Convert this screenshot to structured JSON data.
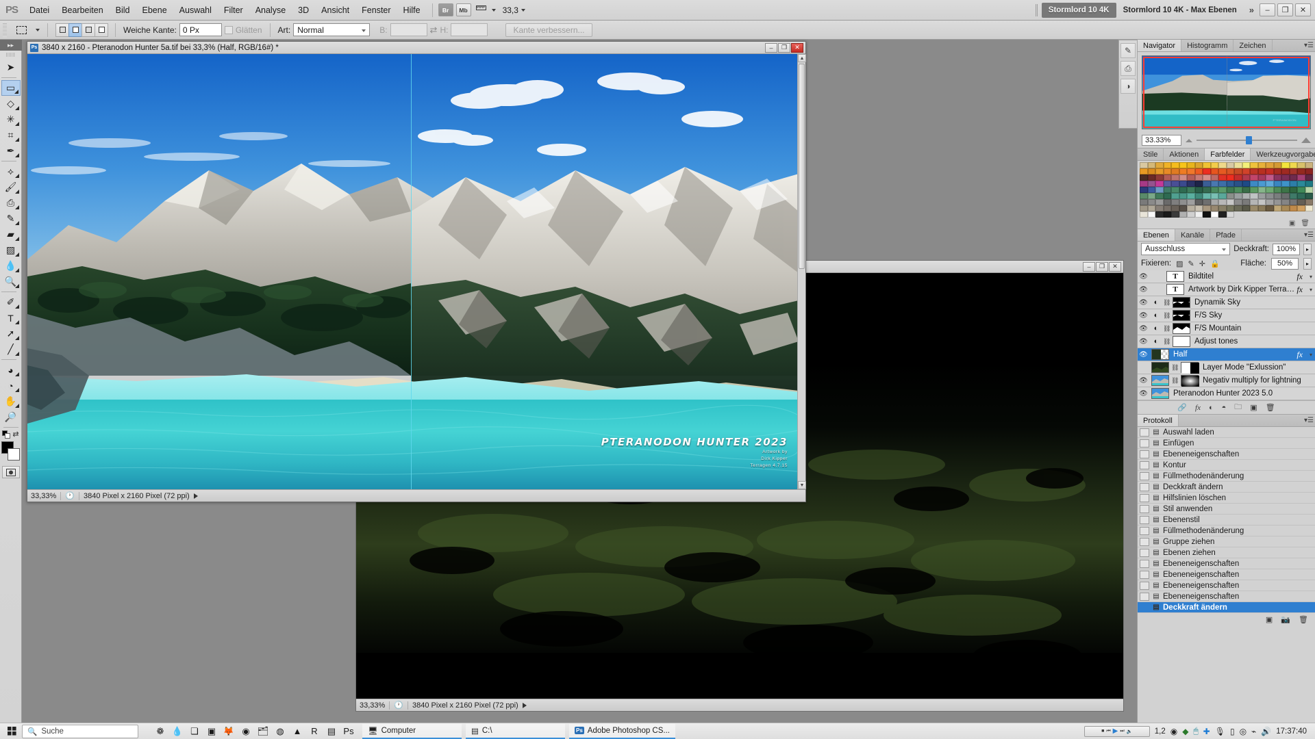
{
  "app": {
    "logo": "PS",
    "menus": [
      "Datei",
      "Bearbeiten",
      "Bild",
      "Ebene",
      "Auswahl",
      "Filter",
      "Analyse",
      "3D",
      "Ansicht",
      "Fenster",
      "Hilfe"
    ],
    "bridge_label": "Br",
    "minibridge_label": "Mb",
    "view_extras_icon": "ruler-icon",
    "zoom_level": "33,3",
    "workspace_tab_active": "Stormlord 10 4K",
    "workspace_tab_secondary": "Stormlord 10 4K - Max Ebenen",
    "overflow_icon": "chevron-double-right-icon",
    "window_minimize": "–",
    "window_restore": "❐",
    "window_close": "✕"
  },
  "options_bar": {
    "tool_icon": "rectangular-marquee-icon",
    "selection_modes": [
      "new-selection",
      "add-to-selection",
      "subtract-from-selection",
      "intersect-selection"
    ],
    "selection_mode_active_index": 1,
    "feather_label": "Weiche Kante:",
    "feather_value": "0 Px",
    "antialias_label": "Glätten",
    "antialias_checked": false,
    "style_label": "Art:",
    "style_value": "Normal",
    "width_label": "B:",
    "width_value": "",
    "swap_icon": "swap-arrows-icon",
    "height_label": "H:",
    "height_value": "",
    "refine_edge_label": "Kante verbessern..."
  },
  "toolbox": {
    "collapse_icon": "double-chevron-right-icon",
    "tools": [
      {
        "name": "move-tool",
        "glyph": "➤",
        "sub": false,
        "selected": false
      },
      {
        "name": "rectangular-marquee-tool",
        "glyph": "▭",
        "sub": true,
        "selected": true
      },
      {
        "name": "lasso-tool",
        "glyph": "◇",
        "sub": true,
        "selected": false
      },
      {
        "name": "magic-wand-tool",
        "glyph": "✳",
        "sub": true,
        "selected": false
      },
      {
        "name": "crop-tool",
        "glyph": "⌗",
        "sub": true,
        "selected": false
      },
      {
        "name": "eyedropper-tool",
        "glyph": "✒",
        "sub": true,
        "selected": false
      },
      {
        "name": "spot-healing-brush-tool",
        "glyph": "⟡",
        "sub": true,
        "selected": false
      },
      {
        "name": "brush-tool",
        "glyph": "🖌",
        "sub": true,
        "selected": false
      },
      {
        "name": "clone-stamp-tool",
        "glyph": "⎙",
        "sub": true,
        "selected": false
      },
      {
        "name": "history-brush-tool",
        "glyph": "✎",
        "sub": true,
        "selected": false
      },
      {
        "name": "eraser-tool",
        "glyph": "▰",
        "sub": true,
        "selected": false
      },
      {
        "name": "gradient-tool",
        "glyph": "▨",
        "sub": true,
        "selected": false
      },
      {
        "name": "blur-tool",
        "glyph": "💧",
        "sub": true,
        "selected": false
      },
      {
        "name": "dodge-tool",
        "glyph": "🔍",
        "sub": true,
        "selected": false
      },
      {
        "name": "pen-tool",
        "glyph": "✐",
        "sub": true,
        "selected": false
      },
      {
        "name": "horizontal-type-tool",
        "glyph": "T",
        "sub": true,
        "selected": false
      },
      {
        "name": "path-selection-tool",
        "glyph": "➚",
        "sub": true,
        "selected": false
      },
      {
        "name": "line-tool",
        "glyph": "╱",
        "sub": true,
        "selected": false
      },
      {
        "name": "3d-object-rotate-tool",
        "glyph": "◕",
        "sub": true,
        "selected": false
      },
      {
        "name": "3d-camera-rotate-tool",
        "glyph": "◔",
        "sub": true,
        "selected": false
      },
      {
        "name": "hand-tool",
        "glyph": "✋",
        "sub": true,
        "selected": false
      },
      {
        "name": "zoom-tool",
        "glyph": "🔎",
        "sub": false,
        "selected": false
      }
    ],
    "foreground_color": "#000000",
    "background_color": "#ffffff",
    "default_colors_icon": "default-colors-icon",
    "swap_colors_icon": "swap-colors-icon",
    "quick_mask_icon": "quick-mask-icon"
  },
  "document_window_1": {
    "app_icon": "photoshop-doc-icon",
    "title": "3840 x 2160 - Pteranodon Hunter 5a.tif bei 33,3% (Half, RGB/16#) *",
    "minimize": "–",
    "maximize": "❐",
    "close": "✕",
    "status_zoom": "33,33%",
    "status_clock_icon": "clock-icon",
    "status_size": "3840 Pixel x 2160 Pixel (72 ppi)",
    "status_arrow_icon": "play-triangle-icon",
    "watermark_title": "PTERANODON HUNTER 2023",
    "watermark_line1": "Artwork by",
    "watermark_line2": "Dirk Kipper",
    "watermark_line3": "Terragen 4.7.15"
  },
  "document_window_2": {
    "minimize": "–",
    "maximize": "❐",
    "close": "✕",
    "status_zoom": "33,33%",
    "status_clock_icon": "clock-icon",
    "status_size": "3840 Pixel x 2160 Pixel (72 ppi)",
    "status_arrow_icon": "play-triangle-icon"
  },
  "icon_strip": [
    {
      "name": "brush-presets-icon",
      "glyph": "🖌"
    },
    {
      "name": "clone-source-icon",
      "glyph": "⎙"
    },
    {
      "name": "masks-icon",
      "glyph": "◑"
    }
  ],
  "navigator_panel": {
    "tabs": [
      "Navigator",
      "Histogramm",
      "Zeichen"
    ],
    "active_tab": "Navigator",
    "menu_icon": "panel-menu-icon",
    "zoom_value": "33.33%",
    "zoom_out_icon": "small-mountain-icon",
    "zoom_in_icon": "large-mountain-icon",
    "slider_position_percent": 49,
    "view_box_color": "#ff3b30"
  },
  "swatches_panel": {
    "tabs": [
      "Stile",
      "Aktionen",
      "Farbfelder",
      "Werkzeugvorgaben"
    ],
    "active_tab": "Farbfelder",
    "menu_icon": "panel-menu-icon",
    "new_swatch_icon": "new-swatch-icon",
    "delete_swatch_icon": "trash-icon",
    "colors": [
      "#d9c8a0",
      "#d4b878",
      "#e0a93c",
      "#f0b227",
      "#f5bc1e",
      "#f7c41a",
      "#e8b41c",
      "#dba52c",
      "#f0c233",
      "#f2cc4a",
      "#efd98a",
      "#d7c9a5",
      "#ece09a",
      "#f4ef7a",
      "#efc23c",
      "#e8b03a",
      "#dfa23a",
      "#d49a35",
      "#f3e43c",
      "#efd84e",
      "#d8c06a",
      "#cbb27d",
      "#e79a24",
      "#d98b1f",
      "#e59a2a",
      "#e88a27",
      "#e07b22",
      "#ef7c23",
      "#f0782b",
      "#ee5b22",
      "#ec2f21",
      "#e7551f",
      "#e55a22",
      "#d95525",
      "#c64a25",
      "#d1432a",
      "#bc3526",
      "#b83020",
      "#c22e25",
      "#a72c21",
      "#9f2a22",
      "#a3352c",
      "#93291f",
      "#8c2420",
      "#4a2b22",
      "#6b2a26",
      "#8e3a36",
      "#b35b55",
      "#c0746d",
      "#d18d87",
      "#b65e58",
      "#c97b76",
      "#d68f8a",
      "#bf6a66",
      "#e03226",
      "#ee2d20",
      "#c42d2c",
      "#b13a4e",
      "#c2456a",
      "#a8395d",
      "#c15a8a",
      "#8a3460",
      "#7b2f58",
      "#6e2b4e",
      "#a33f72",
      "#5f2744",
      "#a63a86",
      "#95538f",
      "#c4399a",
      "#5b5ba0",
      "#4a4f96",
      "#3b4a8e",
      "#2b3266",
      "#1e2448",
      "#3b5e96",
      "#4a78b0",
      "#3d6ea8",
      "#2f5d96",
      "#2a5188",
      "#1f4a86",
      "#3e8ac4",
      "#4b9ad2",
      "#5fa9da",
      "#3a86c0",
      "#3f93c8",
      "#2d7ea8",
      "#2b8a9a",
      "#1f7a84",
      "#2b3a7a",
      "#3b5aa0",
      "#6f9ac4",
      "#3f7b66",
      "#4a8a6a",
      "#2f6b52",
      "#3e7c5c",
      "#2a5f48",
      "#356b50",
      "#4a8a60",
      "#5a9a6a",
      "#3f7a52",
      "#4c8c5c",
      "#3a6e48",
      "#5c9a62",
      "#86b58a",
      "#6ea872",
      "#4f8a58",
      "#3d7448",
      "#2f6640",
      "#3f8a58",
      "#b8d6a8",
      "#5a8a6a",
      "#7aa888",
      "#3f7a5a",
      "#2e6a52",
      "#50a090",
      "#4a9a8a",
      "#5ab0a0",
      "#3f8a7a",
      "#68b8aa",
      "#7ac0b4",
      "#5aa89a",
      "#8a8f8a",
      "#9aa0a0",
      "#b0b4b4",
      "#c0c4c4",
      "#9a9e9e",
      "#8a8e8e",
      "#7a7e7e",
      "#6a6e6e",
      "#3f7a68",
      "#2f6a58",
      "#2a5a4a",
      "#7a7a7a",
      "#8a8a8a",
      "#9a9a9a",
      "#6a6a6a",
      "#7f7f7f",
      "#8f8f8f",
      "#9f9f9f",
      "#5f5f5f",
      "#6f6f6f",
      "#a8a8a8",
      "#b8b8b8",
      "#c8c8c8",
      "#8b8b8b",
      "#7b7b7b",
      "#b5b5b5",
      "#c5c5c5",
      "#a5a5a5",
      "#959595",
      "#858585",
      "#757575",
      "#655f55",
      "#8a7a68",
      "#a09888",
      "#b0a898",
      "#888078",
      "#787068",
      "#686058",
      "#585048",
      "#b8b0a0",
      "#c8c0b0",
      "#a89880",
      "#988870",
      "#888068",
      "#787860",
      "#6a6a58",
      "#5a5a4a",
      "#9a8a6a",
      "#8a7a5a",
      "#6a5a40",
      "#c0a878",
      "#a88a58",
      "#c08a4a",
      "#d0a060",
      "#efe8d0",
      "#e8e4d8",
      "#f8f8f8",
      "#2a2a2a",
      "#1a1a1a",
      "#3a3a3a",
      "#b0b0b0",
      "#d0d0d0",
      "#f0f0f0",
      "#101010",
      "#fcfcfc",
      "#202020",
      "#d8d8d8"
    ]
  },
  "layers_panel": {
    "tabs": [
      "Ebenen",
      "Kanäle",
      "Pfade"
    ],
    "active_tab": "Ebenen",
    "menu_icon": "panel-menu-icon",
    "blend_mode": "Ausschluss",
    "opacity_label": "Deckkraft:",
    "opacity_value": "100%",
    "lock_label": "Fixieren:",
    "lock_icons": [
      "lock-transparent-pixels-icon",
      "lock-image-pixels-icon",
      "lock-position-icon",
      "lock-all-icon"
    ],
    "fill_label": "Fläche:",
    "fill_value": "50%",
    "layers": [
      {
        "name": "Bildtitel",
        "visible": true,
        "type": "text",
        "thumb": "T",
        "indent": true,
        "fx": true,
        "dropdown": true,
        "selected": false
      },
      {
        "name": "Artwork by Dirk Kipper Terragen ...",
        "visible": true,
        "type": "text",
        "thumb": "T",
        "indent": true,
        "fx": true,
        "dropdown": true,
        "selected": false
      },
      {
        "name": "Dynamik Sky",
        "visible": true,
        "type": "adjustment",
        "thumb": "mask-dark",
        "indent": false,
        "fx": false,
        "dropdown": false,
        "selected": false
      },
      {
        "name": "F/S Sky",
        "visible": true,
        "type": "adjustment",
        "thumb": "mask-dark",
        "indent": false,
        "fx": false,
        "dropdown": false,
        "selected": false
      },
      {
        "name": "F/S Mountain",
        "visible": true,
        "type": "adjustment",
        "thumb": "mask-light",
        "indent": false,
        "fx": false,
        "dropdown": false,
        "selected": false
      },
      {
        "name": "Adjust tones",
        "visible": true,
        "type": "adjustment",
        "thumb": "mask-white",
        "indent": false,
        "fx": false,
        "dropdown": false,
        "selected": false
      },
      {
        "name": "Half",
        "visible": true,
        "type": "pixel",
        "thumb": "image-checker",
        "indent": false,
        "fx": true,
        "dropdown": true,
        "selected": true
      },
      {
        "name": "Layer Mode \"Exlussion\"",
        "visible": false,
        "type": "pixel",
        "thumb": "image-dark",
        "indent": false,
        "fx": false,
        "dropdown": false,
        "selected": false
      },
      {
        "name": "Negativ multiply for lightning",
        "visible": true,
        "type": "pixel",
        "thumb": "image-photo",
        "indent": false,
        "fx": false,
        "dropdown": false,
        "selected": false
      },
      {
        "name": "Pteranodon Hunter 2023 5.0",
        "visible": true,
        "type": "pixel",
        "thumb": "image-photo",
        "indent": false,
        "fx": false,
        "dropdown": false,
        "selected": false
      }
    ],
    "footer_icons": [
      "link-layers-icon",
      "layer-style-fx-icon",
      "add-mask-icon",
      "new-adjustment-layer-icon",
      "new-group-icon",
      "new-layer-icon",
      "delete-layer-icon"
    ]
  },
  "history_panel": {
    "tab": "Protokoll",
    "menu_icon": "panel-menu-icon",
    "items": [
      {
        "label": "Auswahl laden",
        "selected": false
      },
      {
        "label": "Einfügen",
        "selected": false
      },
      {
        "label": "Ebeneneigenschaften",
        "selected": false
      },
      {
        "label": "Kontur",
        "selected": false
      },
      {
        "label": "Füllmethodenänderung",
        "selected": false
      },
      {
        "label": "Deckkraft ändern",
        "selected": false
      },
      {
        "label": "Hilfslinien löschen",
        "selected": false
      },
      {
        "label": "Stil anwenden",
        "selected": false
      },
      {
        "label": "Ebenenstil",
        "selected": false
      },
      {
        "label": "Füllmethodenänderung",
        "selected": false
      },
      {
        "label": "Gruppe ziehen",
        "selected": false
      },
      {
        "label": "Ebenen ziehen",
        "selected": false
      },
      {
        "label": "Ebeneneigenschaften",
        "selected": false
      },
      {
        "label": "Ebeneneigenschaften",
        "selected": false
      },
      {
        "label": "Ebeneneigenschaften",
        "selected": false
      },
      {
        "label": "Ebeneneigenschaften",
        "selected": false
      },
      {
        "label": "Deckkraft ändern",
        "selected": true
      }
    ],
    "footer_icons": [
      "new-document-from-state-icon",
      "new-snapshot-icon",
      "delete-state-icon"
    ]
  },
  "taskbar": {
    "start_icon": "windows-start-icon",
    "search_icon": "search-icon",
    "search_placeholder": "Suche",
    "pinned_icons": [
      {
        "name": "photo-viewer-icon",
        "glyph": "❁"
      },
      {
        "name": "water-drop-app-icon",
        "glyph": "💧"
      },
      {
        "name": "task-view-icon",
        "glyph": "❏"
      },
      {
        "name": "camera-app-icon",
        "glyph": "▣"
      },
      {
        "name": "firefox-icon",
        "glyph": "🦊"
      },
      {
        "name": "opera-icon",
        "glyph": "◉"
      },
      {
        "name": "file-explorer-icon",
        "glyph": "🗂"
      },
      {
        "name": "chrome-icon",
        "glyph": "◍"
      },
      {
        "name": "vlc-icon",
        "glyph": "▲"
      },
      {
        "name": "realplayer-icon",
        "glyph": "R"
      },
      {
        "name": "terragen-icon",
        "glyph": "▤"
      },
      {
        "name": "photoshop-icon",
        "glyph": "Ps"
      }
    ],
    "tasks": [
      {
        "name": "computer-task",
        "icon": "computer-icon",
        "label": "Computer"
      },
      {
        "name": "drive-c-task",
        "icon": "drive-icon",
        "label": "C:\\"
      },
      {
        "name": "photoshop-task",
        "icon": "photoshop-icon",
        "label": "Adobe Photoshop CS..."
      }
    ],
    "tray": {
      "media_player_icon": "mini-media-player",
      "ratio_label": "1,2",
      "icons": [
        {
          "name": "colorsync-icon",
          "glyph": "◉"
        },
        {
          "name": "nvidia-icon",
          "glyph": "◆"
        },
        {
          "name": "mouse-settings-icon",
          "glyph": "🖱"
        },
        {
          "name": "bluetooth-icon",
          "glyph": "✚"
        },
        {
          "name": "microphone-icon",
          "glyph": "🎙"
        },
        {
          "name": "usb-device-icon",
          "glyph": "▯"
        },
        {
          "name": "webcam-icon",
          "glyph": "◎"
        },
        {
          "name": "network-icon",
          "glyph": "⌁"
        },
        {
          "name": "volume-icon",
          "glyph": "🔊"
        }
      ],
      "clock": "17:37:40"
    }
  }
}
